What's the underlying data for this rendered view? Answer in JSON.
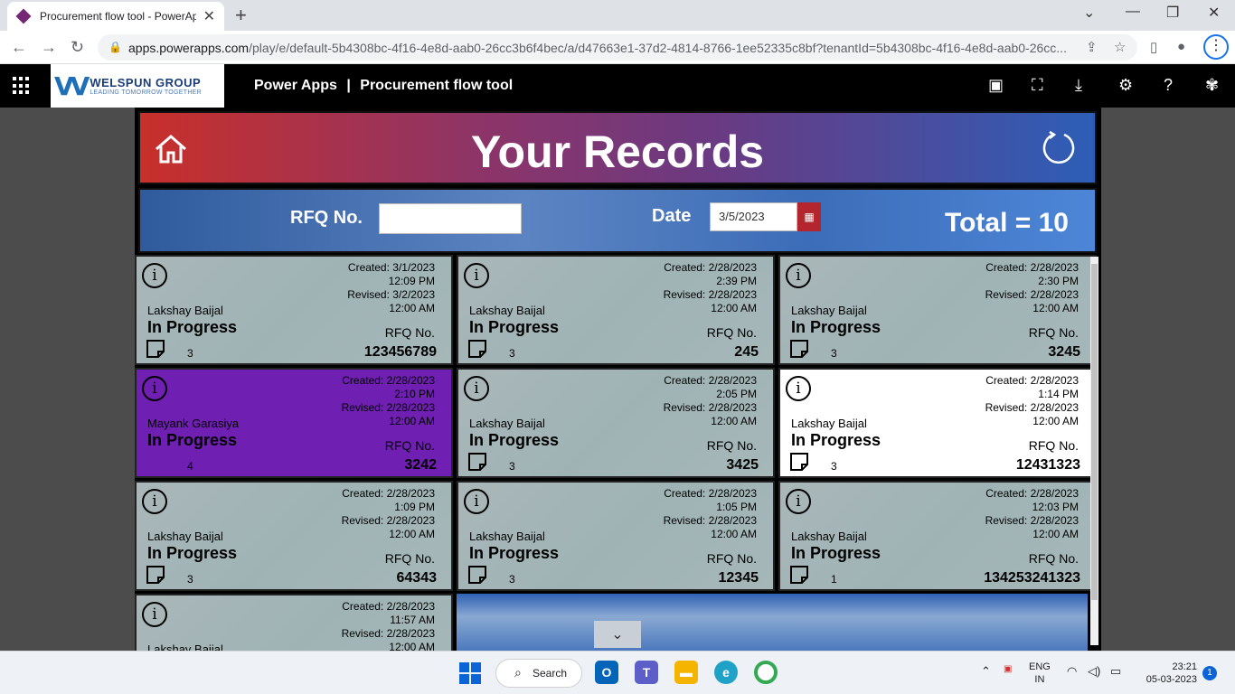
{
  "browser": {
    "tab_title": "Procurement flow tool - PowerAp",
    "url_host": "apps.powerapps.com",
    "url_path": "/play/e/default-5b4308bc-4f16-4e8d-aab0-26cc3b6f4bec/a/d47663e1-37d2-4814-8766-1ee52335c8bf?tenantId=5b4308bc-4f16-4e8d-aab0-26cc..."
  },
  "header": {
    "logo_group": "WELSPUN GROUP",
    "logo_tagline": "LEADING TOMORROW TOGETHER",
    "product": "Power Apps",
    "separator": "|",
    "app_name": "Procurement flow tool"
  },
  "app": {
    "title": "Your Records",
    "rfq_label": "RFQ No.",
    "rfq_value": "",
    "date_label": "Date",
    "date_value": "3/5/2023",
    "total_text": "Total = 10"
  },
  "labels": {
    "created": "Created:",
    "revised": "Revised:",
    "rfq_no": "RFQ No."
  },
  "records": [
    {
      "created_date": "3/1/2023",
      "created_time": "12:09 PM",
      "revised_date": "3/2/2023",
      "revised_time": "12:00 AM",
      "name": "Lakshay Baijal",
      "status": "In Progress",
      "rfq": "123456789",
      "count": "3"
    },
    {
      "created_date": "2/28/2023",
      "created_time": "2:39 PM",
      "revised_date": "2/28/2023",
      "revised_time": "12:00 AM",
      "name": "Lakshay Baijal",
      "status": "In Progress",
      "rfq": "245",
      "count": "3"
    },
    {
      "created_date": "2/28/2023",
      "created_time": "2:30 PM",
      "revised_date": "2/28/2023",
      "revised_time": "12:00 AM",
      "name": "Lakshay Baijal",
      "status": "In Progress",
      "rfq": "3245",
      "count": "3"
    },
    {
      "created_date": "2/28/2023",
      "created_time": "2:10 PM",
      "revised_date": "2/28/2023",
      "revised_time": "12:00 AM",
      "name": "Mayank Garasiya",
      "status": "In Progress",
      "rfq": "3242",
      "count": "4"
    },
    {
      "created_date": "2/28/2023",
      "created_time": "2:05 PM",
      "revised_date": "2/28/2023",
      "revised_time": "12:00 AM",
      "name": "Lakshay Baijal",
      "status": "In Progress",
      "rfq": "3425",
      "count": "3"
    },
    {
      "created_date": "2/28/2023",
      "created_time": "1:14 PM",
      "revised_date": "2/28/2023",
      "revised_time": "12:00 AM",
      "name": "Lakshay Baijal",
      "status": "In Progress",
      "rfq": "12431323",
      "count": "3"
    },
    {
      "created_date": "2/28/2023",
      "created_time": "1:09 PM",
      "revised_date": "2/28/2023",
      "revised_time": "12:00 AM",
      "name": "Lakshay Baijal",
      "status": "In Progress",
      "rfq": "64343",
      "count": "3"
    },
    {
      "created_date": "2/28/2023",
      "created_time": "1:05 PM",
      "revised_date": "2/28/2023",
      "revised_time": "12:00 AM",
      "name": "Lakshay Baijal",
      "status": "In Progress",
      "rfq": "12345",
      "count": "3"
    },
    {
      "created_date": "2/28/2023",
      "created_time": "12:03 PM",
      "revised_date": "2/28/2023",
      "revised_time": "12:00 AM",
      "name": "Lakshay Baijal",
      "status": "In Progress",
      "rfq": "134253241323",
      "count": "1"
    },
    {
      "created_date": "2/28/2023",
      "created_time": "11:57 AM",
      "revised_date": "2/28/2023",
      "revised_time": "12:00 AM",
      "name": "Lakshay Baijal"
    }
  ],
  "taskbar": {
    "search_label": "Search",
    "lang_1": "ENG",
    "lang_2": "IN",
    "time": "23:21",
    "date": "05-03-2023",
    "notification_count": "1"
  }
}
